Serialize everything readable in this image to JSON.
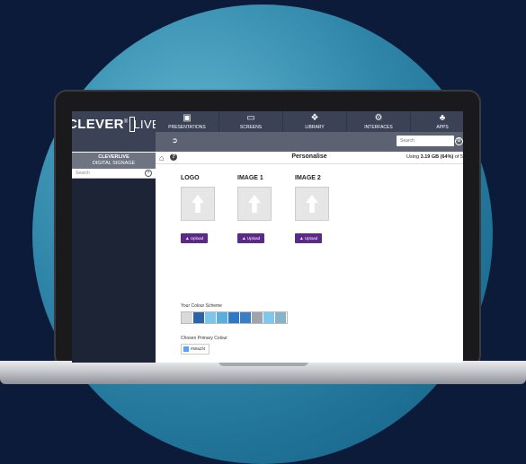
{
  "brand": {
    "name": "CLEVER",
    "reg": "®",
    "suffix": "LIVE"
  },
  "sidebar": {
    "title_line1": "CLEVERLIVE",
    "title_line2": "DIGITAL SIGNAGE",
    "search_placeholder": "Search"
  },
  "nav": {
    "items": [
      {
        "label": "PRESENTATIONS",
        "icon": "presentation-icon"
      },
      {
        "label": "SCREENS",
        "icon": "monitor-icon"
      },
      {
        "label": "LIBRARY",
        "icon": "library-icon"
      },
      {
        "label": "INTERFACES",
        "icon": "interfaces-icon"
      },
      {
        "label": "APPS",
        "icon": "apps-icon"
      }
    ],
    "search_placeholder": "Search"
  },
  "page": {
    "title": "Personalise",
    "usage_prefix": "Using ",
    "usage_value": "3.19 GB (64%)",
    "usage_suffix": " of 5"
  },
  "images": [
    {
      "label": "LOGO",
      "button": "Upload"
    },
    {
      "label": "IMAGE 1",
      "button": "Upload"
    },
    {
      "label": "IMAGE 2",
      "button": "Upload"
    }
  ],
  "colour_scheme": {
    "label": "Your Colour Scheme",
    "colors": [
      "#d9d9d9",
      "#2b63a8",
      "#7cc6ee",
      "#59aee0",
      "#2f79c4",
      "#3a7fc6",
      "#9ea4aa",
      "#7ec8f0",
      "#88b2c6"
    ]
  },
  "primary_colour": {
    "label": "Chosen Primary Colour",
    "hex": "#59a2f4",
    "swatch": "#59a2f4"
  }
}
